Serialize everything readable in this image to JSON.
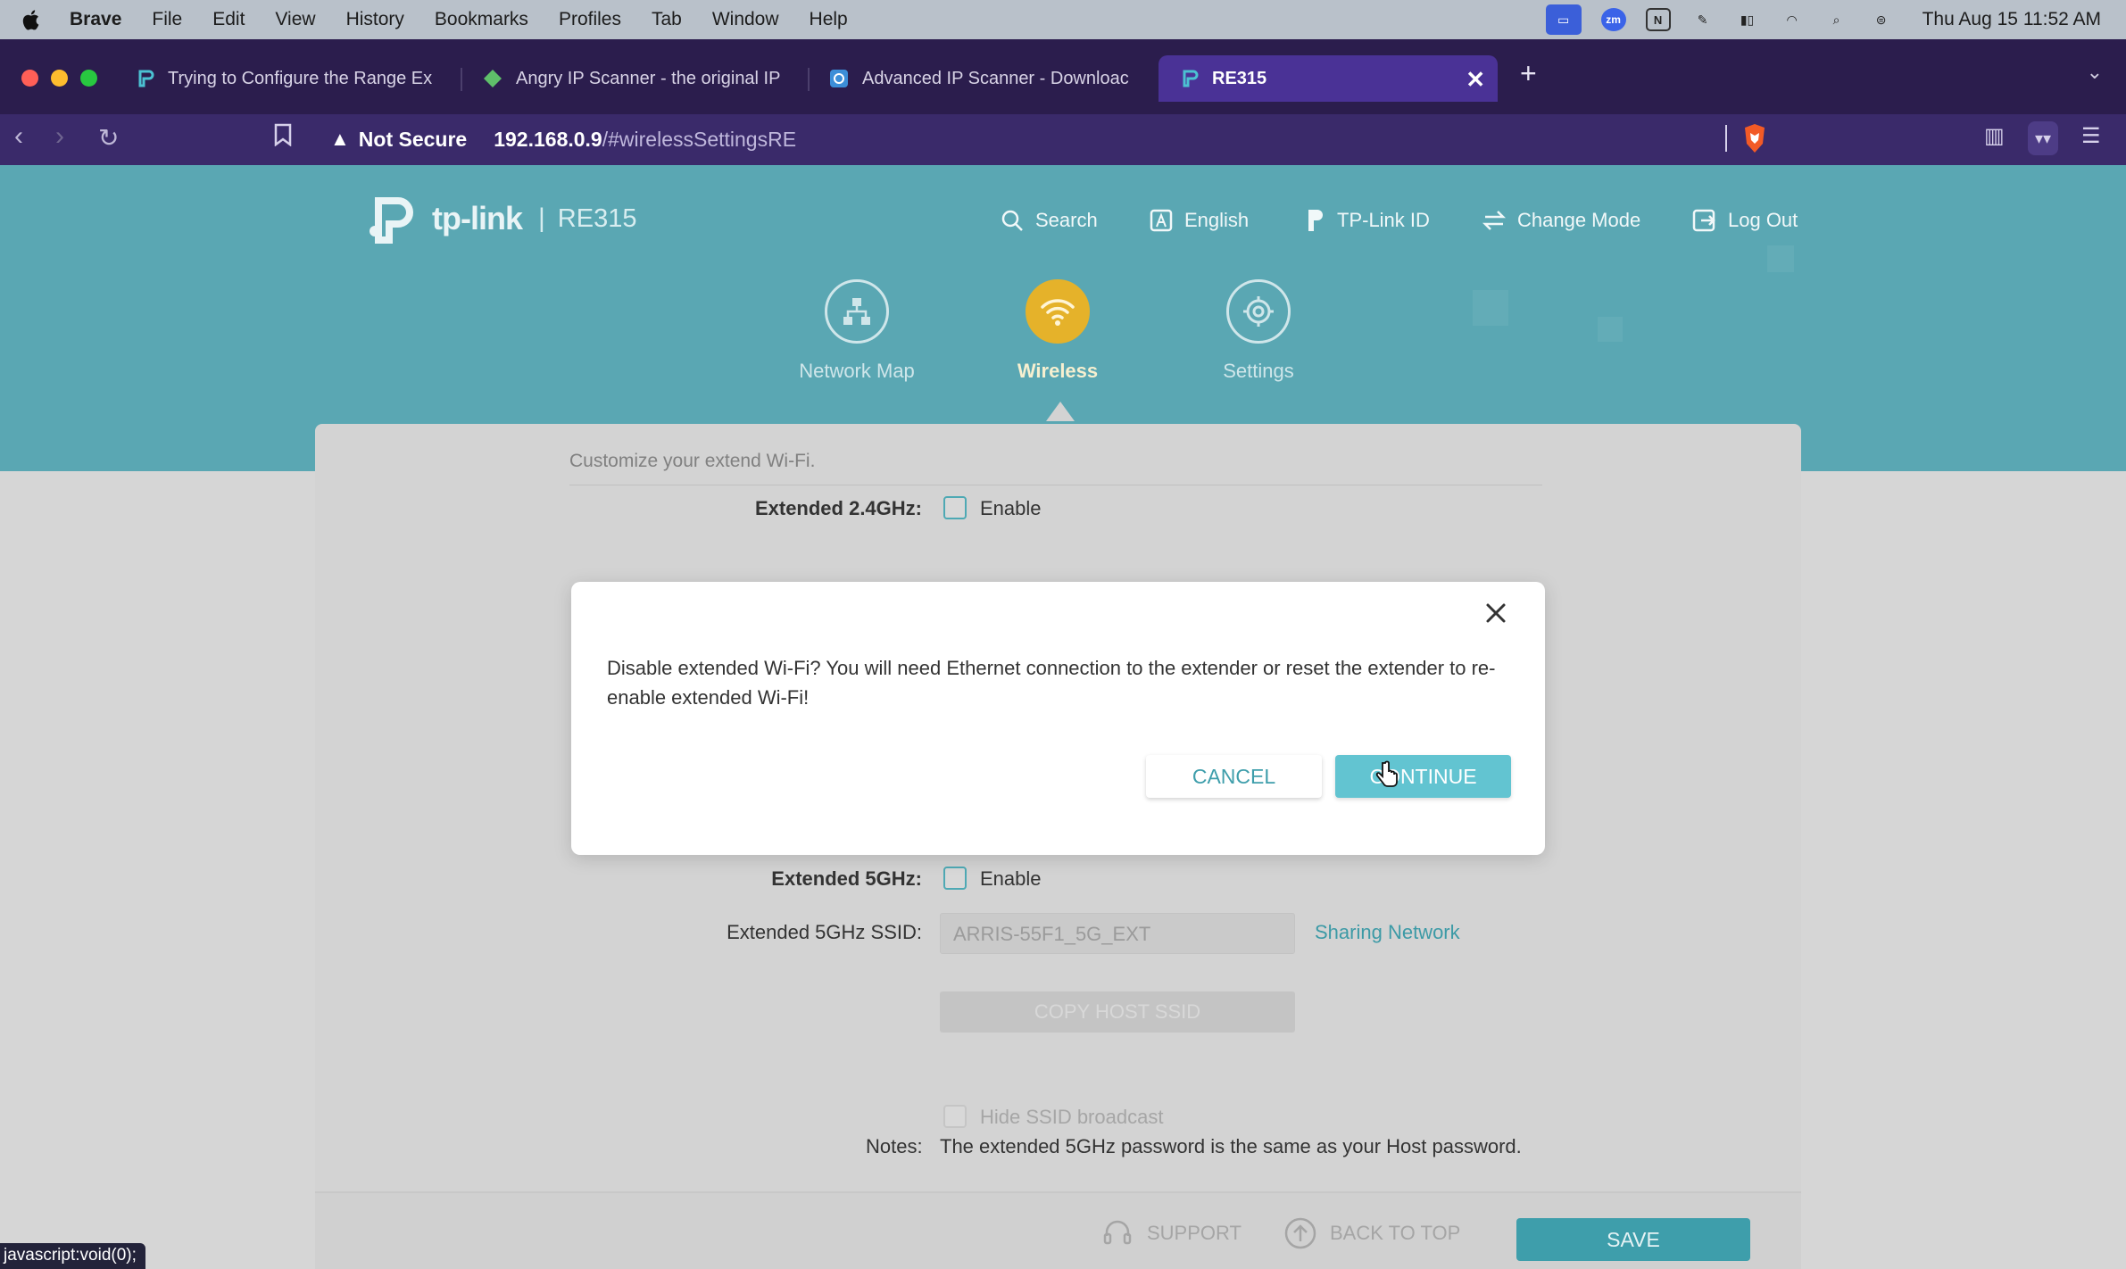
{
  "menubar": {
    "app": "Brave",
    "items": [
      "File",
      "Edit",
      "View",
      "History",
      "Bookmarks",
      "Profiles",
      "Tab",
      "Window",
      "Help"
    ],
    "clock": "Thu Aug 15  11:52 AM"
  },
  "tabs": [
    {
      "title": "Trying to Configure the Range Ex"
    },
    {
      "title": "Angry IP Scanner - the original IP"
    },
    {
      "title": "Advanced IP Scanner - Downloac"
    },
    {
      "title": "RE315"
    }
  ],
  "address": {
    "security": "Not Secure",
    "host": "192.168.0.9",
    "path": "/#wirelessSettingsRE"
  },
  "header": {
    "brand": "tp-link",
    "model": "RE315",
    "links": {
      "search": "Search",
      "language": "English",
      "tplink_id": "TP-Link ID",
      "change_mode": "Change Mode",
      "logout": "Log Out"
    },
    "nav": {
      "network_map": "Network Map",
      "wireless": "Wireless",
      "settings": "Settings"
    }
  },
  "content": {
    "subtitle": "Customize your extend Wi-Fi.",
    "ext24_label": "Extended 2.4GHz:",
    "ext24_enable": "Enable",
    "ext5_label": "Extended 5GHz:",
    "ext5_enable": "Enable",
    "ssid5_label": "Extended 5GHz SSID:",
    "ssid5_value": "ARRIS-55F1_5G_EXT",
    "sharing_network": "Sharing Network",
    "copy_host_ssid": "COPY HOST SSID",
    "hide_ssid": "Hide SSID broadcast",
    "notes_label": "Notes:",
    "notes_text": "The extended 5GHz password is the same as your Host password."
  },
  "footer": {
    "support": "SUPPORT",
    "back_to_top": "BACK TO TOP",
    "save": "SAVE"
  },
  "modal": {
    "message": "Disable extended Wi-Fi? You will need Ethernet connection to the extender or reset the extender to re-enable extended Wi-Fi!",
    "cancel": "CANCEL",
    "continue": "CONTINUE"
  },
  "statusbar": "javascript:void(0);"
}
